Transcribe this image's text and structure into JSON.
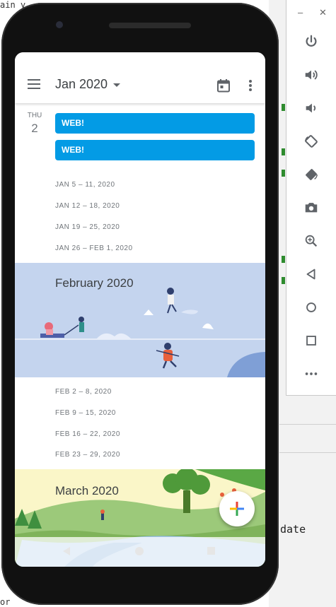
{
  "ide": {
    "top_left_text": "ain y",
    "bottom_left_text": "or",
    "code_fragment": "date"
  },
  "emulator_toolbar": {
    "minimize_label": "–",
    "close_label": "✕",
    "tools": [
      "power-icon",
      "volume-up-icon",
      "volume-down-icon",
      "rotate-left-icon",
      "rotate-right-icon",
      "camera-icon",
      "zoom-icon",
      "back-icon",
      "home-icon",
      "overview-icon",
      "more-icon"
    ]
  },
  "app": {
    "title": "Jan 2020",
    "day": {
      "dow": "THU",
      "num": "2"
    },
    "events": [
      "WEB!",
      "WEB!"
    ],
    "jan_weeks": [
      "JAN 5 – 11, 2020",
      "JAN 12 – 18, 2020",
      "JAN 19 – 25, 2020",
      "JAN 26 – FEB 1, 2020"
    ],
    "feb_title": "February 2020",
    "feb_weeks": [
      "FEB 2 – 8, 2020",
      "FEB 9 – 15, 2020",
      "FEB 16 – 22, 2020",
      "FEB 23 – 29, 2020"
    ],
    "mar_title": "March 2020"
  },
  "colors": {
    "event_chip": "#039be5",
    "feb_banner": "#c4d4ee",
    "mar_banner": "#9cc97a"
  }
}
